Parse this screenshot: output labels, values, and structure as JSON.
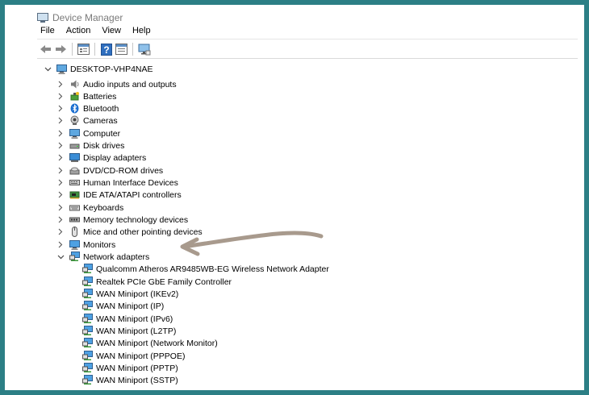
{
  "window": {
    "title": "Device Manager"
  },
  "menu": [
    "File",
    "Action",
    "View",
    "Help"
  ],
  "toolbar": {
    "buttons": [
      {
        "name": "back-arrow-icon"
      },
      {
        "name": "forward-arrow-icon"
      },
      {
        "name": "properties-icon"
      },
      {
        "name": "help-icon"
      },
      {
        "name": "update-driver-icon"
      },
      {
        "name": "scan-hardware-icon"
      }
    ]
  },
  "tree": {
    "root": "DESKTOP-VHP4NAE",
    "categories": [
      {
        "label": "Audio inputs and outputs",
        "icon": "speaker-icon"
      },
      {
        "label": "Batteries",
        "icon": "battery-icon"
      },
      {
        "label": "Bluetooth",
        "icon": "bluetooth-icon"
      },
      {
        "label": "Cameras",
        "icon": "camera-icon"
      },
      {
        "label": "Computer",
        "icon": "computer-icon"
      },
      {
        "label": "Disk drives",
        "icon": "disk-drive-icon"
      },
      {
        "label": "Display adapters",
        "icon": "display-adapter-icon"
      },
      {
        "label": "DVD/CD-ROM drives",
        "icon": "dvd-drive-icon"
      },
      {
        "label": "Human Interface Devices",
        "icon": "hid-icon"
      },
      {
        "label": "IDE ATA/ATAPI controllers",
        "icon": "ide-controller-icon"
      },
      {
        "label": "Keyboards",
        "icon": "keyboard-icon"
      },
      {
        "label": "Memory technology devices",
        "icon": "memory-icon"
      },
      {
        "label": "Mice and other pointing devices",
        "icon": "mouse-icon"
      },
      {
        "label": "Monitors",
        "icon": "monitor-icon"
      },
      {
        "label": "Network adapters",
        "icon": "network-adapter-icon",
        "expanded": true
      }
    ],
    "network_adapters": [
      "Qualcomm Atheros AR9485WB-EG Wireless Network Adapter",
      "Realtek PCIe GbE Family Controller",
      "WAN Miniport (IKEv2)",
      "WAN Miniport (IP)",
      "WAN Miniport (IPv6)",
      "WAN Miniport (L2TP)",
      "WAN Miniport (Network Monitor)",
      "WAN Miniport (PPPOE)",
      "WAN Miniport (PPTP)",
      "WAN Miniport (SSTP)"
    ]
  },
  "colors": {
    "border": "#2c7f85",
    "annotation_arrow": "#a89a8d"
  }
}
